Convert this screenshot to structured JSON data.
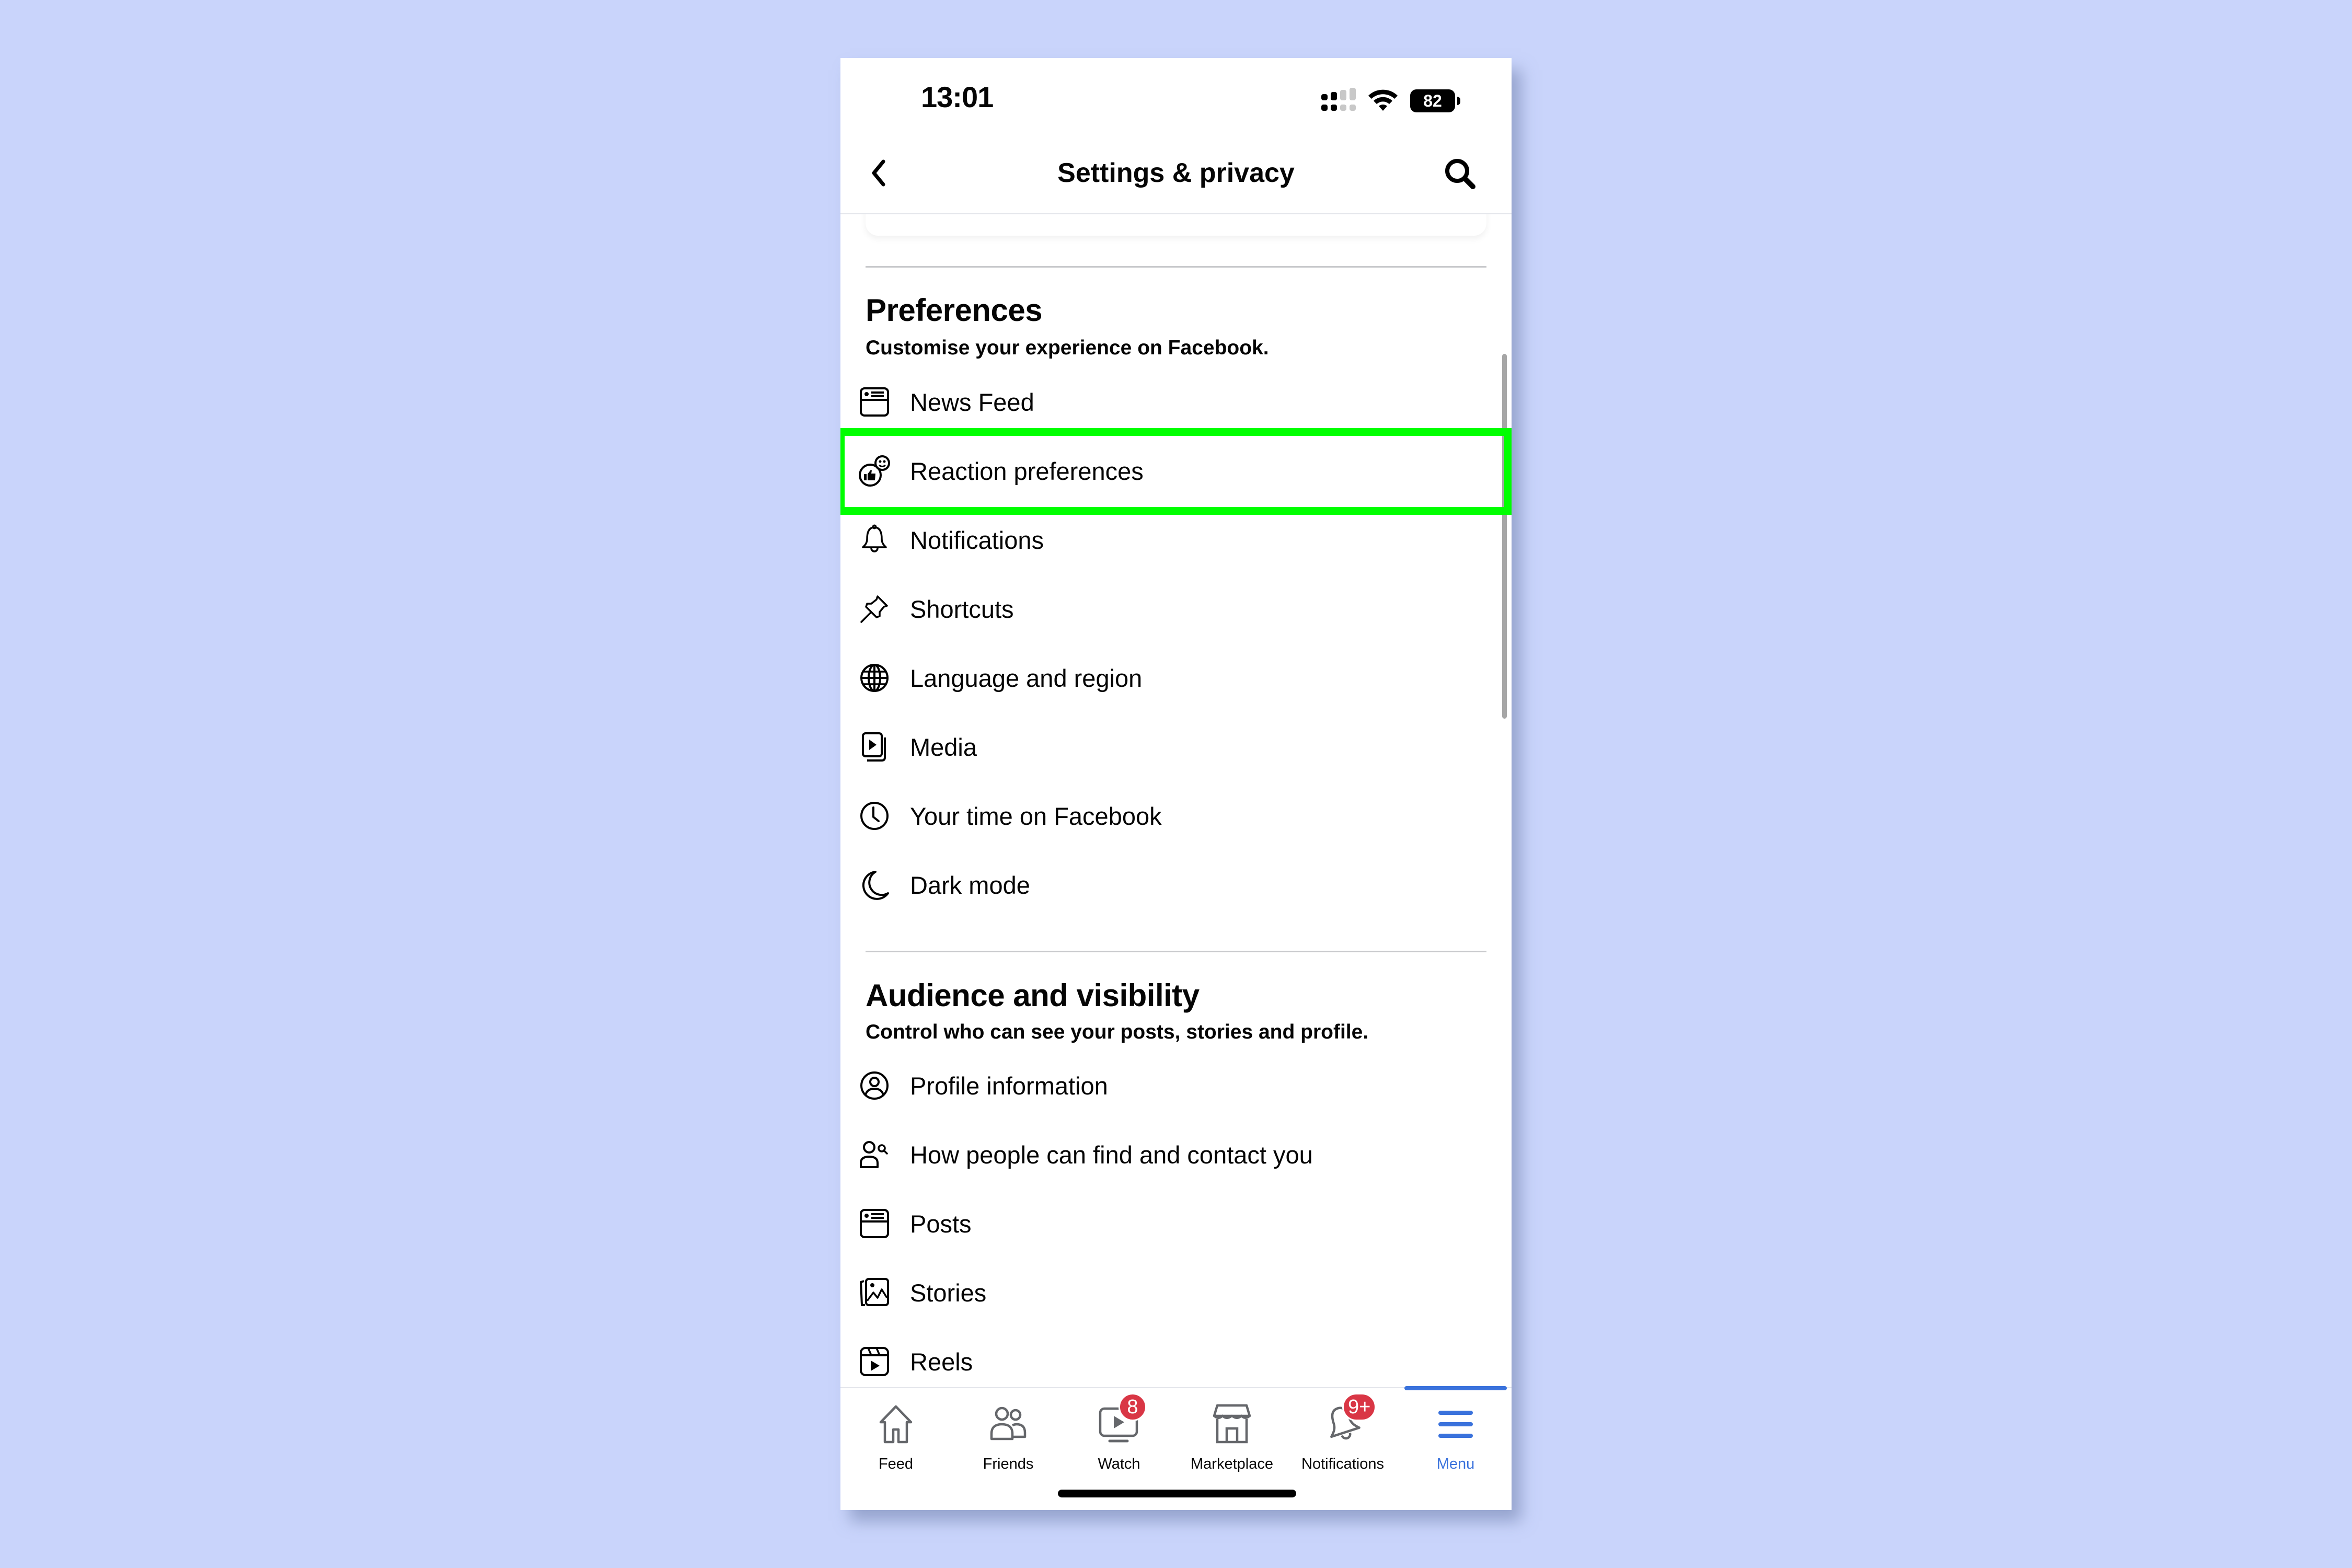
{
  "status_bar": {
    "time": "13:01",
    "battery": "82",
    "icons": [
      "dual-signal-icon",
      "wifi-icon",
      "battery-icon"
    ]
  },
  "header": {
    "title": "Settings & privacy",
    "back_icon": "chevron-left-icon",
    "search_icon": "search-icon"
  },
  "sections": [
    {
      "title": "Preferences",
      "subtitle": "Customise your experience on Facebook.",
      "items": [
        {
          "label": "News Feed",
          "icon": "news-feed-icon"
        },
        {
          "label": "Reaction preferences",
          "icon": "reaction-icon",
          "highlighted": true
        },
        {
          "label": "Notifications",
          "icon": "bell-icon"
        },
        {
          "label": "Shortcuts",
          "icon": "pin-icon"
        },
        {
          "label": "Language and region",
          "icon": "globe-icon"
        },
        {
          "label": "Media",
          "icon": "media-icon"
        },
        {
          "label": "Your time on Facebook",
          "icon": "clock-icon"
        },
        {
          "label": "Dark mode",
          "icon": "moon-icon"
        }
      ]
    },
    {
      "title": "Audience and visibility",
      "subtitle": "Control who can see your posts, stories and profile.",
      "items": [
        {
          "label": "Profile information",
          "icon": "profile-icon"
        },
        {
          "label": "How people can find and contact you",
          "icon": "find-people-icon"
        },
        {
          "label": "Posts",
          "icon": "posts-icon"
        },
        {
          "label": "Stories",
          "icon": "stories-icon"
        },
        {
          "label": "Reels",
          "icon": "reels-icon"
        }
      ]
    }
  ],
  "tab_bar": {
    "tabs": [
      {
        "label": "Feed",
        "icon": "home-icon"
      },
      {
        "label": "Friends",
        "icon": "friends-icon"
      },
      {
        "label": "Watch",
        "icon": "watch-icon",
        "badge": "8"
      },
      {
        "label": "Marketplace",
        "icon": "marketplace-icon"
      },
      {
        "label": "Notifications",
        "icon": "bell-icon",
        "badge": "9+"
      },
      {
        "label": "Menu",
        "icon": "menu-icon",
        "active": true
      }
    ]
  },
  "colors": {
    "background": "#c9d4fb",
    "highlight": "#00ff00",
    "accent": "#3a72dc",
    "badge": "#d93645",
    "icon_grey": "#65676b"
  }
}
